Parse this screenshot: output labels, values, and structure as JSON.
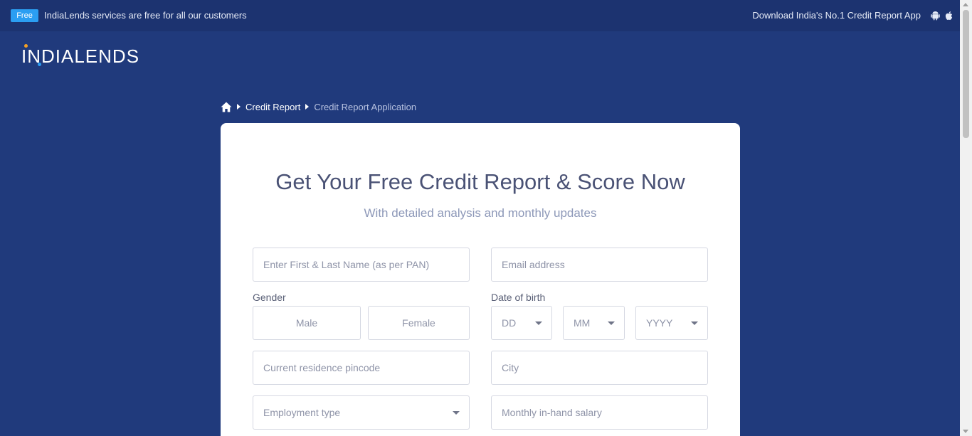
{
  "topbar": {
    "badge": "Free",
    "message": "IndiaLends services are free for all our customers",
    "download_text": "Download India's No.1 Credit Report App",
    "icons": [
      "android-icon",
      "apple-icon"
    ]
  },
  "logo": {
    "text": "INDIALENDS"
  },
  "breadcrumb": {
    "home_icon": "home-icon",
    "items": [
      "Credit Report",
      "Credit Report Application"
    ]
  },
  "form": {
    "title": "Get Your Free Credit Report & Score Now",
    "subtitle": "With detailed analysis and monthly updates",
    "name_placeholder": "Enter First & Last Name (as per PAN)",
    "email_placeholder": "Email address",
    "gender_label": "Gender",
    "gender_options": [
      "Male",
      "Female"
    ],
    "dob_label": "Date of birth",
    "dob_day": "DD",
    "dob_month": "MM",
    "dob_year": "YYYY",
    "pincode_placeholder": "Current residence pincode",
    "city_placeholder": "City",
    "employment_placeholder": "Employment type",
    "salary_placeholder": "Monthly in-hand salary"
  },
  "colors": {
    "page_bg": "#203a7c",
    "topbar_bg": "#1c3370",
    "badge_bg": "#2b9ef2",
    "title_color": "#4a5275",
    "subtitle_color": "#8d98b8",
    "logo_dot_orange": "#f4a024",
    "logo_dot_blue": "#2b9ef2"
  }
}
